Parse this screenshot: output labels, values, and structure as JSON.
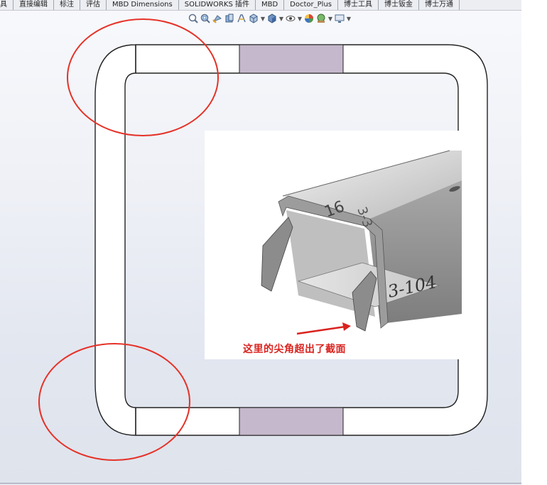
{
  "toolbar": {
    "tabs": [
      {
        "label": "具"
      },
      {
        "label": "直接编辑"
      },
      {
        "label": "标注"
      },
      {
        "label": "评估"
      },
      {
        "label": "MBD Dimensions"
      },
      {
        "label": "SOLIDWORKS 插件"
      },
      {
        "label": "MBD"
      },
      {
        "label": "Doctor_Plus"
      },
      {
        "label": "博士工具"
      },
      {
        "label": "博士钣金"
      },
      {
        "label": "博士万通"
      }
    ]
  },
  "headsup_icons": [
    "zoom-to-fit-icon",
    "zoom-to-area-icon",
    "previous-view-icon",
    "section-view-icon",
    "dynamic-annotation-icon",
    "view-orientation-icon",
    "display-style-icon",
    "hide-show-items-icon",
    "edit-appearance-icon",
    "apply-scene-icon",
    "view-settings-icon"
  ],
  "colors": {
    "highlight_fill": "#c5b8cc",
    "callout_circle": "#e53228",
    "annotation_text": "#d9231f",
    "part_gray": "#8c8c8c"
  },
  "inset": {
    "engraving_side": "3-104",
    "engraving_top_a": "16",
    "engraving_top_b": "3-3"
  },
  "annotation": {
    "text": "这里的尖角超出了截面"
  }
}
